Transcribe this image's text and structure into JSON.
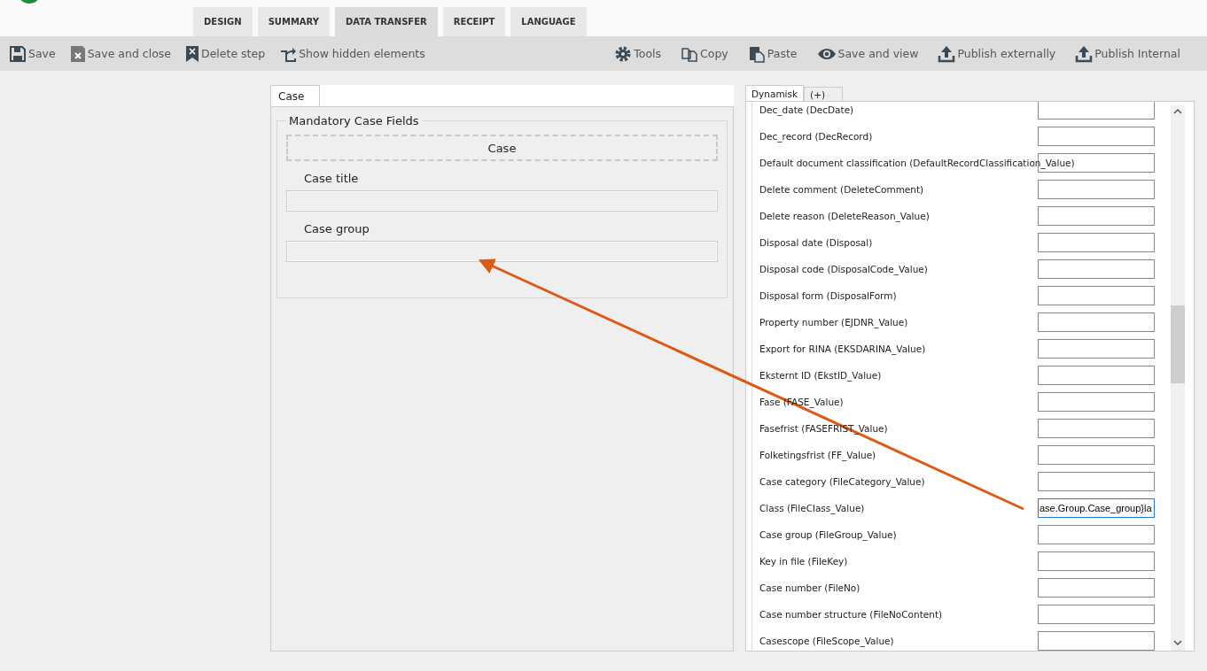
{
  "tabs": [
    {
      "label": "DESIGN",
      "selected": false
    },
    {
      "label": "SUMMARY",
      "selected": false
    },
    {
      "label": "DATA TRANSFER",
      "selected": true
    },
    {
      "label": "RECEIPT",
      "selected": false
    },
    {
      "label": "LANGUAGE",
      "selected": false
    }
  ],
  "toolbar": {
    "left": [
      {
        "label": "Save"
      },
      {
        "label": "Save and close"
      },
      {
        "label": "Delete step"
      },
      {
        "label": "Show hidden elements"
      }
    ],
    "right": [
      {
        "label": "Tools"
      },
      {
        "label": "Copy"
      },
      {
        "label": "Paste"
      },
      {
        "label": "Save and view"
      },
      {
        "label": "Publish externally"
      },
      {
        "label": "Publish Internal"
      }
    ]
  },
  "form_panel": {
    "tabs": [
      {
        "label": "Case",
        "selected": true
      }
    ],
    "group_title": "Mandatory Case Fields",
    "section_title": "Case",
    "fields": [
      {
        "label": "Case title"
      },
      {
        "label": "Case group"
      }
    ]
  },
  "mapping_panel": {
    "tabs": [
      {
        "label": "Dynamisk",
        "selected": true
      },
      {
        "label": "(+)",
        "selected": false
      }
    ],
    "rows": [
      {
        "label": "Dec_date (DecDate)",
        "value": "",
        "focused": false
      },
      {
        "label": "Dec_record (DecRecord)",
        "value": "",
        "focused": false
      },
      {
        "label": "Default document classification (DefaultRecordClassification_Value)",
        "value": "",
        "focused": false
      },
      {
        "label": "Delete comment (DeleteComment)",
        "value": "",
        "focused": false
      },
      {
        "label": "Delete reason (DeleteReason_Value)",
        "value": "",
        "focused": false
      },
      {
        "label": "Disposal date (Disposal)",
        "value": "",
        "focused": false
      },
      {
        "label": "Disposal code (DisposalCode_Value)",
        "value": "",
        "focused": false
      },
      {
        "label": "Disposal form (DisposalForm)",
        "value": "",
        "focused": false
      },
      {
        "label": "Property number (EJDNR_Value)",
        "value": "",
        "focused": false
      },
      {
        "label": "Export for RINA (EKSDARINA_Value)",
        "value": "",
        "focused": false
      },
      {
        "label": "Eksternt ID (EkstID_Value)",
        "value": "",
        "focused": false
      },
      {
        "label": "Fase (FASE_Value)",
        "value": "",
        "focused": false
      },
      {
        "label": "Fasefrist (FASEFRIST_Value)",
        "value": "",
        "focused": false
      },
      {
        "label": "Folketingsfrist (FF_Value)",
        "value": "",
        "focused": false
      },
      {
        "label": "Case category (FileCategory_Value)",
        "value": "",
        "focused": false
      },
      {
        "label": "Class (FileClass_Value)",
        "value": "ase.Group.Case_group}la",
        "focused": true
      },
      {
        "label": "Case group (FileGroup_Value)",
        "value": "",
        "focused": false
      },
      {
        "label": "Key in file (FileKey)",
        "value": "",
        "focused": false
      },
      {
        "label": "Case number (FileNo)",
        "value": "",
        "focused": false
      },
      {
        "label": "Case number structure (FileNoContent)",
        "value": "",
        "focused": false
      },
      {
        "label": "Casescope (FileScope_Value)",
        "value": "",
        "focused": false
      }
    ]
  }
}
